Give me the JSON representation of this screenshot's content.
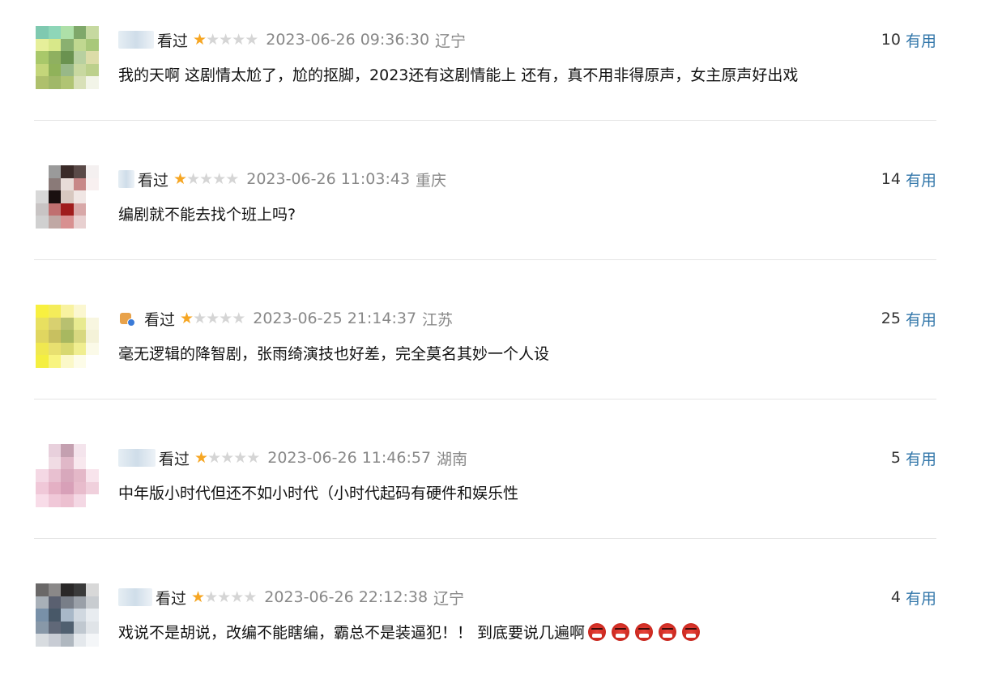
{
  "comments": [
    {
      "status": "看过",
      "rating": 1,
      "max_rating": 5,
      "time": "2023-06-26 09:36:30",
      "region": "辽宁",
      "votes": "10",
      "vote_label": "有用",
      "text": "我的天啊 这剧情太尬了，尬的抠脚，2023还有这剧情能上 还有，真不用非得原声，女主原声好出戏",
      "avatar_colors": [
        "#7fc9b0",
        "#8ed6b8",
        "#aee0a8",
        "#7fa86a",
        "#c6d9a0",
        "#e6ef9a",
        "#d8e88a",
        "#8ab070",
        "#c0d890",
        "#a8c87a",
        "#a9c86a",
        "#8fb060",
        "#6a9250",
        "#b8d0a0",
        "#dcdca8",
        "#c4d67a",
        "#90b25a",
        "#98b888",
        "#c8d8a0",
        "#bcd08c",
        "#aec06c",
        "#a0b868",
        "#b0c474",
        "#d8e0b8",
        "#f2f4e8"
      ]
    },
    {
      "status": "看过",
      "rating": 1,
      "max_rating": 5,
      "time": "2023-06-26 11:03:43",
      "region": "重庆",
      "votes": "14",
      "vote_label": "有用",
      "text": "编剧就不能去找个班上吗?",
      "avatar_colors": [
        "#ffffff",
        "#9a9a9a",
        "#3a2a28",
        "#5a4a48",
        "#f4f0f0",
        "#ffffff",
        "#8a7a78",
        "#e8dcd8",
        "#c88888",
        "#f8f0f0",
        "#d8d8d8",
        "#1a1010",
        "#d8c8c0",
        "#f0e6e4",
        "#ffffff",
        "#c8c4c4",
        "#c07070",
        "#a01c1c",
        "#d8a8a8",
        "#ffffff",
        "#d0d0d0",
        "#c0a8a4",
        "#d89090",
        "#e8d0d0",
        "#ffffff"
      ]
    },
    {
      "status": "看过",
      "rating": 1,
      "max_rating": 5,
      "time": "2023-06-25 21:14:37",
      "region": "江苏",
      "votes": "25",
      "vote_label": "有用",
      "text": "毫无逻辑的降智剧，张雨绮演技也好差，完全莫名其妙一个人设",
      "avatar_colors": [
        "#f8f040",
        "#f4ec5a",
        "#f8f2a0",
        "#fbf7d0",
        "#ffffff",
        "#e8e060",
        "#d8d070",
        "#b8c070",
        "#e8ea90",
        "#f8f6e0",
        "#e0d660",
        "#c8c060",
        "#a8b860",
        "#d8d880",
        "#f4f2d8",
        "#f0e850",
        "#e8e070",
        "#d8d870",
        "#f0ee90",
        "#fbfae8",
        "#f4ef40",
        "#f8f480",
        "#fbf8c8",
        "#fdfce8",
        "#ffffff"
      ]
    },
    {
      "status": "看过",
      "rating": 1,
      "max_rating": 5,
      "time": "2023-06-26 11:46:57",
      "region": "湖南",
      "votes": "5",
      "vote_label": "有用",
      "text": "中年版小时代但还不如小时代（小时代起码有硬件和娱乐性",
      "avatar_colors": [
        "#ffffff",
        "#e8d0dc",
        "#c4a0b0",
        "#f4e4ec",
        "#ffffff",
        "#ffffff",
        "#f0dce4",
        "#e0b8c8",
        "#f8e8ee",
        "#ffffff",
        "#f4d8e4",
        "#e8c0d0",
        "#d8a8bc",
        "#e4b8c8",
        "#f8e4ec",
        "#f0c8d8",
        "#e4b0c4",
        "#d8a0b8",
        "#e8bccc",
        "#f0d0dc",
        "#f8dce8",
        "#f0c8d8",
        "#ecc0d0",
        "#f4d8e4",
        "#ffffff"
      ]
    },
    {
      "status": "看过",
      "rating": 1,
      "max_rating": 5,
      "time": "2023-06-26 22:12:38",
      "region": "辽宁",
      "votes": "4",
      "vote_label": "有用",
      "text": "戏说不是胡说，改编不能瞎编，霸总不是装逼犯！！ 到底要说几遍啊",
      "emoji_count": 5,
      "avatar_colors": [
        "#6a6868",
        "#8a8888",
        "#2a2828",
        "#3a3a3a",
        "#d8d8d8",
        "#a8b0b8",
        "#5a6070",
        "#787e88",
        "#9aa0a8",
        "#c8ccd0",
        "#7890a8",
        "#485868",
        "#a8b8c8",
        "#d0d8e0",
        "#e8ecf0",
        "#8898a8",
        "#606878",
        "#506070",
        "#c0c8d0",
        "#e0e4e8",
        "#d8dce0",
        "#c8ccd4",
        "#b0b8c0",
        "#e4e8ec",
        "#f4f6f8"
      ]
    }
  ]
}
